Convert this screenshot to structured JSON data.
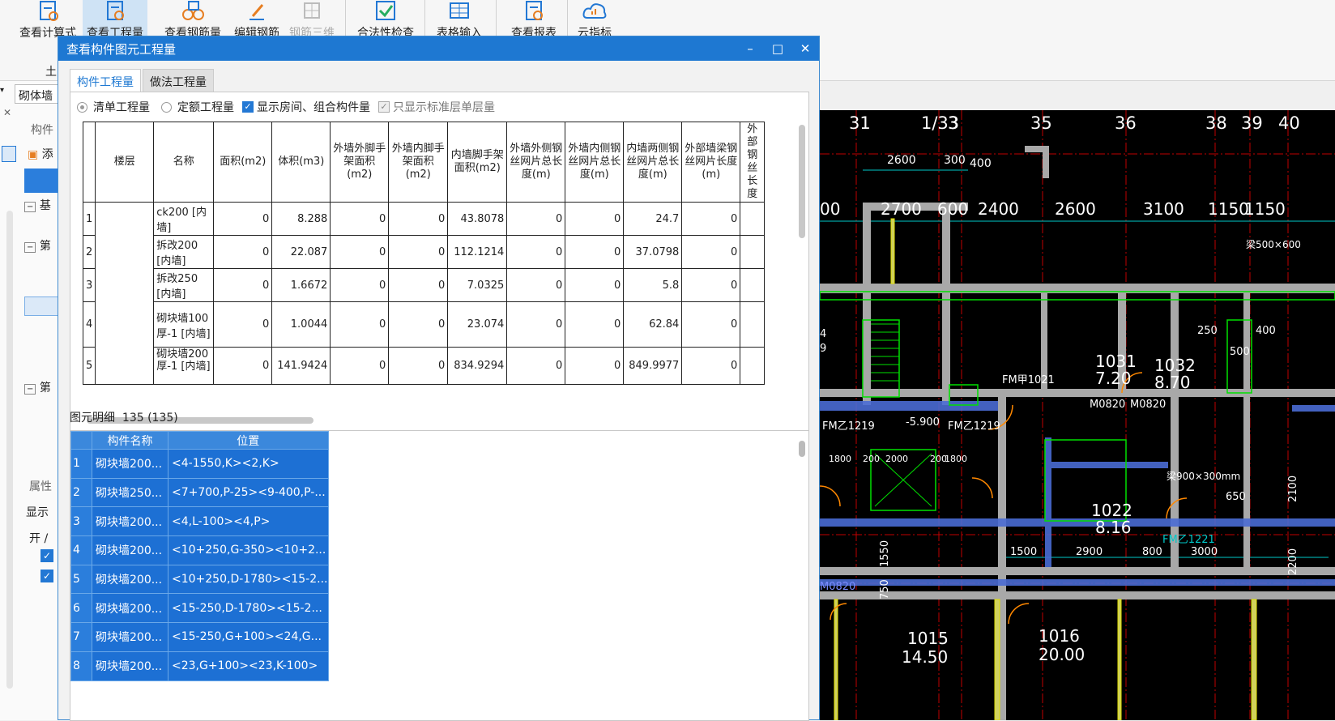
{
  "ribbon": {
    "buttons": [
      {
        "label": "查看计算式",
        "icon": "calc-view-icon"
      },
      {
        "label": "查看工程量",
        "icon": "quantity-view-icon"
      },
      {
        "label": "查看钢筋量",
        "icon": "rebar-view-icon"
      },
      {
        "label": "编辑钢筋",
        "icon": "edit-rebar-icon"
      },
      {
        "label": "钢筋三维",
        "icon": "rebar-3d-icon"
      },
      {
        "label": "合法性检查",
        "icon": "check-icon"
      },
      {
        "label": "表格输入",
        "icon": "table-input-icon"
      },
      {
        "label": "查看报表",
        "icon": "report-icon"
      },
      {
        "label": "云指标",
        "icon": "cloud-index-icon"
      }
    ],
    "group_label": "土"
  },
  "left_panel": {
    "combo_value": "砌体墙",
    "section_label": "构件",
    "add_label": "添",
    "tree_nodes": [
      "基",
      "第",
      "第"
    ],
    "props_label": "属性",
    "show_label": "显示",
    "open_label": "开 /"
  },
  "dialog": {
    "title": "查看构件图元工程量",
    "controls": {
      "minimize": "–",
      "maximize": "□",
      "close": "✕"
    },
    "tabs": [
      "构件工程量",
      "做法工程量"
    ],
    "options": {
      "radio1": "清单工程量",
      "radio2": "定额工程量",
      "check1": "显示房间、组合构件量",
      "check2": "只显示标准层单层量"
    },
    "table": {
      "headers": [
        "楼层",
        "名称",
        "面积(m2)",
        "体积(m3)",
        "外墙外脚手架面积(m2)",
        "外墙内脚手架面积(m2)",
        "内墙脚手架面积(m2)",
        "外墙外侧钢丝网片总长度(m)",
        "外墙内侧钢丝网片总长度(m)",
        "内墙两侧钢丝网片总长度(m)",
        "外部墙梁钢丝网片长度(m)",
        "外部钢丝长度"
      ],
      "rows": [
        {
          "idx": "1",
          "name": "ck200 [内墙]",
          "v": [
            "0",
            "8.288",
            "0",
            "0",
            "43.8078",
            "0",
            "0",
            "24.7",
            "0"
          ]
        },
        {
          "idx": "2",
          "name": "拆改200 [内墙]",
          "v": [
            "0",
            "22.087",
            "0",
            "0",
            "112.1214",
            "0",
            "0",
            "37.0798",
            "0"
          ]
        },
        {
          "idx": "3",
          "name": "拆改250 [内墙]",
          "v": [
            "0",
            "1.6672",
            "0",
            "0",
            "7.0325",
            "0",
            "0",
            "5.8",
            "0"
          ]
        },
        {
          "idx": "4",
          "name": "砌块墙100厚-1 [内墙]",
          "v": [
            "0",
            "1.0044",
            "0",
            "0",
            "23.074",
            "0",
            "0",
            "62.84",
            "0"
          ]
        },
        {
          "idx": "5",
          "name": "砌块墙200厚-1 [内墙]",
          "v": [
            "0",
            "141.9424",
            "0",
            "0",
            "834.9294",
            "0",
            "0",
            "849.9977",
            "0"
          ]
        }
      ]
    },
    "detail_label": "图元明细",
    "detail_count": "135 (135)",
    "detail_headers": [
      "构件名称",
      "位置"
    ],
    "detail_rows": [
      {
        "idx": "1",
        "name": "砌块墙200...",
        "pos": "<4-1550,K><2,K>"
      },
      {
        "idx": "2",
        "name": "砌块墙250...",
        "pos": "<7+700,P-25><9-400,P-..."
      },
      {
        "idx": "3",
        "name": "砌块墙200...",
        "pos": "<4,L-100><4,P>"
      },
      {
        "idx": "4",
        "name": "砌块墙200...",
        "pos": "<10+250,G-350><10+2..."
      },
      {
        "idx": "5",
        "name": "砌块墙200...",
        "pos": "<10+250,D-1780><15-2..."
      },
      {
        "idx": "6",
        "name": "砌块墙200...",
        "pos": "<15-250,D-1780><15-2..."
      },
      {
        "idx": "7",
        "name": "砌块墙200...",
        "pos": "<15-250,G+100><24,G..."
      },
      {
        "idx": "8",
        "name": "砌块墙200...",
        "pos": "<23,G+100><23,K-100>"
      }
    ]
  },
  "cad": {
    "axis_labels": [
      "31",
      "1/33",
      "3",
      "35",
      "36",
      "38",
      "39",
      "40"
    ],
    "dimensions_top": [
      "2600",
      "300",
      "400"
    ],
    "dimensions_main": [
      "00",
      "2700",
      "600",
      "2400",
      "2600",
      "3100",
      "1150",
      "1150"
    ],
    "rooms": [
      {
        "id": "1031",
        "area": "7.20"
      },
      {
        "id": "1032",
        "area": "8.70"
      },
      {
        "id": "1022",
        "area": "8.16"
      },
      {
        "id": "1015",
        "area": "14.50"
      },
      {
        "id": "1016",
        "area": "20.00"
      }
    ],
    "misc_labels": [
      "FM乙1219",
      "FM乙1219",
      "FM甲1021",
      "M0820",
      "M0820",
      "M0820",
      "-5.900",
      "1800",
      "200",
      "2000",
      "200",
      "1800",
      "1500",
      "2900",
      "800",
      "3000",
      "250",
      "500",
      "400",
      "650",
      "梁500×600",
      "梁900×300mm",
      "FM乙1221",
      "1550",
      "750",
      "2100",
      "2200",
      "4",
      "9"
    ]
  }
}
